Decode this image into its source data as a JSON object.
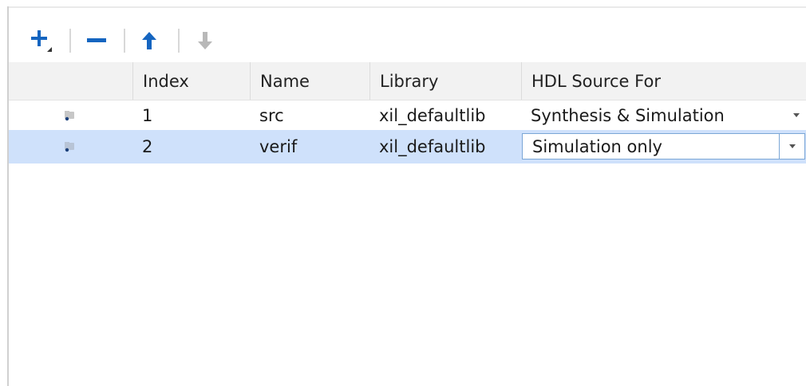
{
  "toolbar": {
    "add_icon": "plus-icon",
    "remove_icon": "minus-icon",
    "up_icon": "arrow-up-icon",
    "down_icon": "arrow-down-icon"
  },
  "table": {
    "headers": {
      "index": "Index",
      "name": "Name",
      "library": "Library",
      "hdl_source_for": "HDL Source For"
    },
    "rows": [
      {
        "icon": "folder-icon",
        "index": "1",
        "name": "src",
        "library": "xil_defaultlib",
        "hdl_source_for": "Synthesis & Simulation",
        "selected": false
      },
      {
        "icon": "folder-icon",
        "index": "2",
        "name": "verif",
        "library": "xil_defaultlib",
        "hdl_source_for": "Simulation only",
        "selected": true
      }
    ]
  },
  "colors": {
    "accent_blue": "#1565c0",
    "selection": "#cfe1fb",
    "header_bg": "#f2f2f2"
  }
}
